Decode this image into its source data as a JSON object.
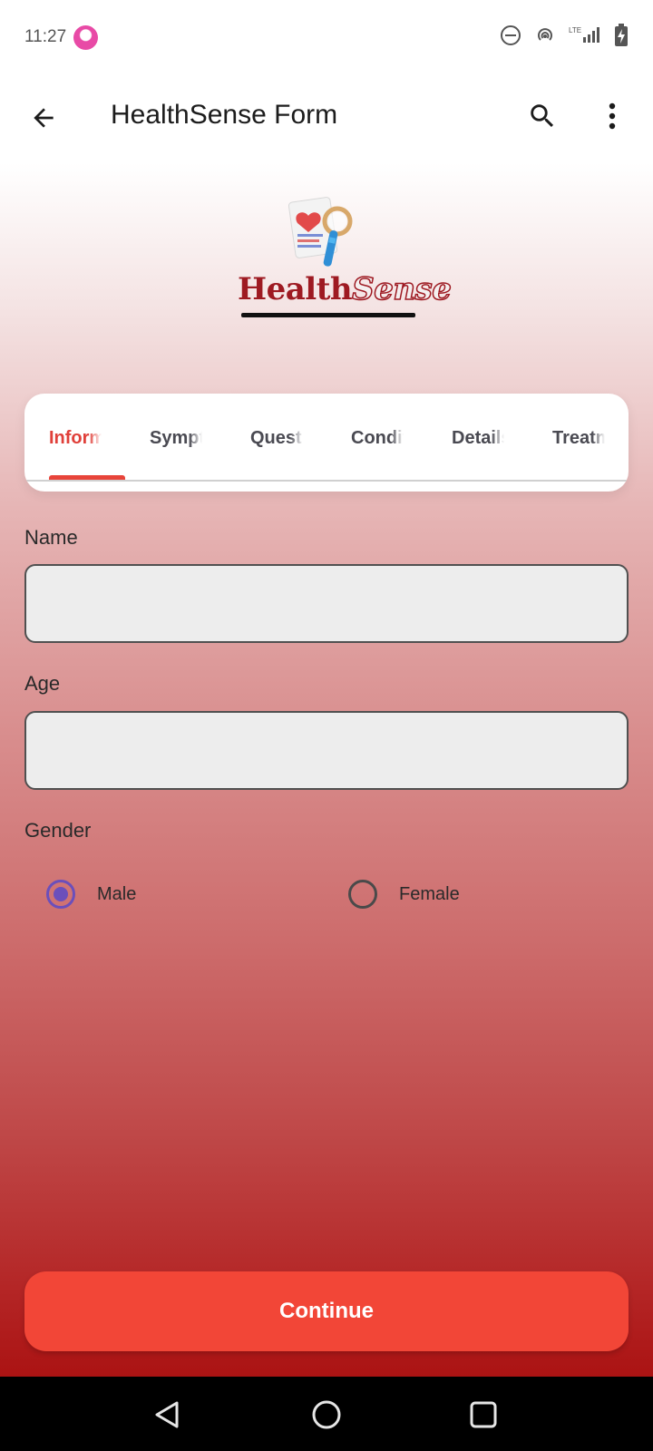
{
  "status_bar": {
    "time": "11:27",
    "icons": [
      "dnd-icon",
      "hotspot-icon",
      "lte-signal-icon",
      "battery-charging-icon"
    ],
    "network_label": "LTE"
  },
  "app_bar": {
    "title": "HealthSense Form",
    "icons": [
      "back-arrow-icon",
      "search-icon",
      "more-vert-icon"
    ]
  },
  "logo": {
    "word_part1": "Health",
    "word_part2": "Sense"
  },
  "tabs": [
    {
      "label": "Information",
      "active": true
    },
    {
      "label": "Symptoms",
      "active": false
    },
    {
      "label": "Questions",
      "active": false
    },
    {
      "label": "Conditions",
      "active": false
    },
    {
      "label": "Details",
      "active": false
    },
    {
      "label": "Treatment",
      "active": false
    }
  ],
  "form": {
    "name_label": "Name",
    "name_value": "",
    "age_label": "Age",
    "age_value": "",
    "gender_label": "Gender",
    "gender_options": [
      {
        "label": "Male",
        "selected": true
      },
      {
        "label": "Female",
        "selected": false
      }
    ]
  },
  "continue_label": "Continue",
  "colors": {
    "accent": "#f24637",
    "tab_active": "#e0403a",
    "radio": "#6b4fbb",
    "brand_dark_red": "#9e1a22"
  },
  "nav_bar": {
    "icons": [
      "nav-back-icon",
      "nav-home-icon",
      "nav-recents-icon"
    ]
  }
}
